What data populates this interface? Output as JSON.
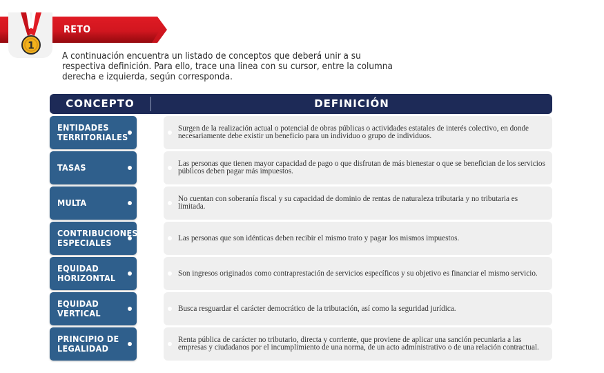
{
  "header": {
    "title": "RETO",
    "medal_number": "1",
    "colors": {
      "ribbon": "#e01b24",
      "medal_gold": "#f2b21c"
    }
  },
  "instructions": "A continuación encuentra un listado de conceptos que deberá unir a su respectiva definición. Para ello, trace una linea con su cursor, entre la columna derecha e izquierda, según corresponda.",
  "table": {
    "header_concept": "CONCEPTO",
    "header_definition": "DEFINICIÓN",
    "colors": {
      "header_bg": "#1d2a57",
      "concept_bg": "#2f5f8c",
      "definition_bg": "#efefef"
    },
    "concepts": [
      {
        "label": "ENTIDADES TERRITORIALES"
      },
      {
        "label": "TASAS"
      },
      {
        "label": "MULTA"
      },
      {
        "label": "CONTRIBUCIONES ESPECIALES"
      },
      {
        "label": "EQUIDAD HORIZONTAL"
      },
      {
        "label": "EQUIDAD VERTICAL"
      },
      {
        "label": "PRINCIPIO DE LEGALIDAD"
      }
    ],
    "definitions": [
      {
        "text": "Surgen de la realización actual o potencial de obras públicas o actividades estatales de interés colectivo, en donde necesariamente debe existir un beneficio para un individuo o grupo de individuos."
      },
      {
        "text": "Las personas que tienen mayor capacidad de pago o que disfrutan de más bienestar o que se benefician de los servicios públicos deben pagar más impuestos."
      },
      {
        "text": "No cuentan con soberanía fiscal y su capacidad de dominio de rentas de naturaleza tributaria y no tributaria es limitada."
      },
      {
        "text": "Las personas que son idénticas deben recibir el mismo trato y pagar los mismos impuestos."
      },
      {
        "text": "Son ingresos originados como contraprestación de servicios específicos y su objetivo es financiar el mismo servicio."
      },
      {
        "text": "Busca resguardar el carácter democrático de la tributación, así como la seguridad jurídica."
      },
      {
        "text": "Renta pública de carácter no tributario, directa y corriente, que proviene de aplicar una sanción pecuniaria a las empresas y ciudadanos por el incumplimiento de una norma, de un acto administrativo o de una relación contractual."
      }
    ]
  }
}
